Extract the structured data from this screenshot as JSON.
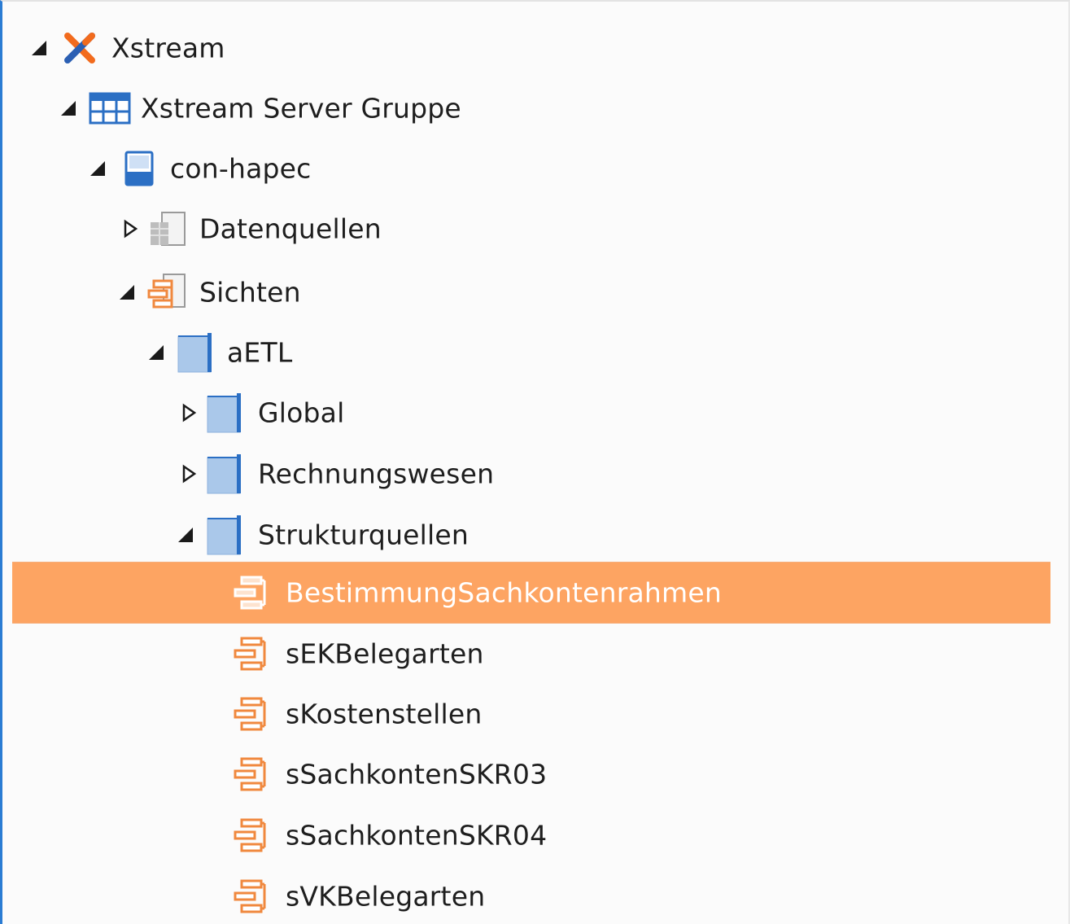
{
  "colors": {
    "accent_border": "#2b7cd3",
    "selection": "#fda462",
    "folder_blue": "#aac8ea",
    "orange": "#f0883e"
  },
  "tree": {
    "nodes": [
      {
        "label": "Xstream",
        "state": "expanded",
        "icon": "xstream-logo-icon"
      },
      {
        "label": "Xstream Server Gruppe",
        "state": "expanded",
        "icon": "server-group-icon"
      },
      {
        "label": "con-hapec",
        "state": "expanded",
        "icon": "server-icon"
      },
      {
        "label": "Datenquellen",
        "state": "collapsed",
        "icon": "datasource-icon"
      },
      {
        "label": "Sichten",
        "state": "expanded",
        "icon": "views-icon"
      },
      {
        "label": "aETL",
        "state": "expanded",
        "icon": "folder-icon"
      },
      {
        "label": "Global",
        "state": "collapsed",
        "icon": "folder-icon"
      },
      {
        "label": "Rechnungswesen",
        "state": "collapsed",
        "icon": "folder-icon"
      },
      {
        "label": "Strukturquellen",
        "state": "expanded",
        "icon": "folder-icon"
      },
      {
        "label": "BestimmungSachkontenrahmen",
        "state": "leaf",
        "icon": "structure-icon",
        "selected": true
      },
      {
        "label": "sEKBelegarten",
        "state": "leaf",
        "icon": "structure-icon"
      },
      {
        "label": "sKostenstellen",
        "state": "leaf",
        "icon": "structure-icon"
      },
      {
        "label": "sSachkontenSKR03",
        "state": "leaf",
        "icon": "structure-icon"
      },
      {
        "label": "sSachkontenSKR04",
        "state": "leaf",
        "icon": "structure-icon"
      },
      {
        "label": "sVKBelegarten",
        "state": "leaf",
        "icon": "structure-icon"
      }
    ]
  }
}
